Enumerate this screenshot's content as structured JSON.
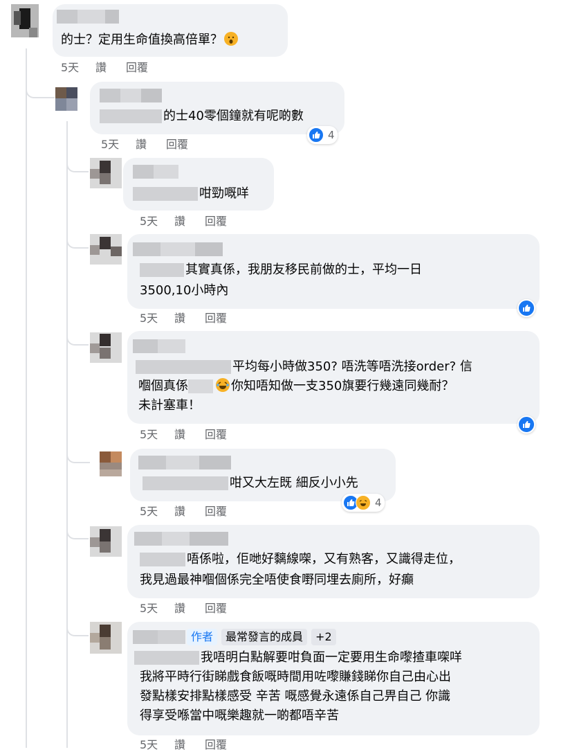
{
  "actions": {
    "time": "5天",
    "like": "讚",
    "reply": "回覆"
  },
  "comments": [
    {
      "id": "c1",
      "text": "的士？定用生命值換高倍單？"
    },
    {
      "id": "c2",
      "text": "的士40零個鐘就有呢啲數",
      "reaction_count": "4"
    },
    {
      "id": "c3",
      "text": "咁勁嘅咩"
    },
    {
      "id": "c4",
      "line1": "其實真係，我朋友移民前做的士，平均一日",
      "line2": "3500,10小時內"
    },
    {
      "id": "c5",
      "line1": "平均每小時做350? 唔洗等唔洗接order? 信",
      "line2a": "嗰個真係",
      "line2b": "你知唔知做一支350旗要行幾遠同幾耐？",
      "line3": "未計塞車！"
    },
    {
      "id": "c6",
      "text": "咁又大左既 細反小小先",
      "reaction_count": "4"
    },
    {
      "id": "c7",
      "line1": "唔係啦，佢哋好黐線㗎，又有熟客，又識得走位，",
      "line2": "我見過最神嗰個係完全唔使食嘢同埋去廁所，好癲"
    },
    {
      "id": "c8",
      "badges": [
        "作者",
        "最常發言的成員",
        "+2"
      ],
      "line1": "我唔明白點解要咁負面一定要用生命嚟揸車㗎咩",
      "line2": "我將平時行街睇戲食飯嘅時間用咗嚟賺錢睇你自己由心出",
      "line3": "發點樣安排點樣感受 辛苦 嘅感覺永遠係自己畀自己 你識",
      "line4": "得享受喺當中嘅樂趣就一啲都唔辛苦"
    }
  ],
  "colors": {
    "accent": "#1877f2",
    "bubble": "#f0f2f5",
    "meta": "#65676b"
  },
  "icons": {
    "like": "thumbs-up-icon",
    "haha": "laughing-face-icon",
    "emoji": "yawning-face-icon"
  }
}
